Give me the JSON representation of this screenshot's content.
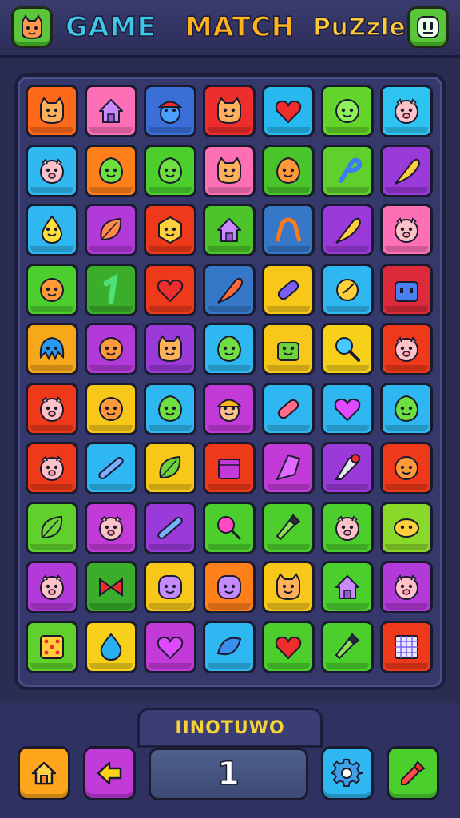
{
  "header": {
    "title_word_1": "GAME",
    "title_word_2": "MATCH",
    "title_word_3": "PuZzle",
    "left_icon": "cat-face-icon",
    "right_icon": "monster-face-icon"
  },
  "board": {
    "rows": 10,
    "cols": 7,
    "tiles": [
      [
        {
          "color": "#ff6a1a",
          "icon": "cat"
        },
        {
          "color": "#ff6fb5",
          "icon": "house"
        },
        {
          "color": "#3a6fd8",
          "icon": "cap-face"
        },
        {
          "color": "#ee2d2d",
          "icon": "cat"
        },
        {
          "color": "#28b8f0",
          "icon": "heart"
        },
        {
          "color": "#62d42a",
          "icon": "face"
        },
        {
          "color": "#2ec4f2",
          "icon": "pig"
        }
      ],
      [
        {
          "color": "#30b8f0",
          "icon": "pig"
        },
        {
          "color": "#ff7f1a",
          "icon": "blob"
        },
        {
          "color": "#4ccf2c",
          "icon": "blob"
        },
        {
          "color": "#ff6fb5",
          "icon": "cat"
        },
        {
          "color": "#49c42a",
          "icon": "blob-orange"
        },
        {
          "color": "#5fd02c",
          "icon": "hook"
        },
        {
          "color": "#9a3ad8",
          "icon": "feather"
        }
      ],
      [
        {
          "color": "#2eb7f0",
          "icon": "drop-face"
        },
        {
          "color": "#b23ad8",
          "icon": "leaf"
        },
        {
          "color": "#ee3a1a",
          "icon": "hex-face"
        },
        {
          "color": "#4cc42a",
          "icon": "house"
        },
        {
          "color": "#3677c8",
          "icon": "arch"
        },
        {
          "color": "#9a3ad8",
          "icon": "feather"
        },
        {
          "color": "#ff6fb5",
          "icon": "pig"
        }
      ],
      [
        {
          "color": "#4ccf2c",
          "icon": "face-orange"
        },
        {
          "color": "#3aae2a",
          "icon": "number-one"
        },
        {
          "color": "#ee3a1a",
          "icon": "heart"
        },
        {
          "color": "#3677c8",
          "icon": "feather-red"
        },
        {
          "color": "#f7c81a",
          "icon": "pill"
        },
        {
          "color": "#2eb7f0",
          "icon": "clock"
        },
        {
          "color": "#dd2a3a",
          "icon": "robot"
        }
      ],
      [
        {
          "color": "#f7a81a",
          "icon": "octopus"
        },
        {
          "color": "#b23ad8",
          "icon": "face-orange"
        },
        {
          "color": "#9a3ad8",
          "icon": "cat"
        },
        {
          "color": "#2eb7f0",
          "icon": "blob"
        },
        {
          "color": "#f7c81a",
          "icon": "tank"
        },
        {
          "color": "#f7d01a",
          "icon": "magnifier"
        },
        {
          "color": "#ee3a1a",
          "icon": "pig"
        }
      ],
      [
        {
          "color": "#ee3a1a",
          "icon": "pig"
        },
        {
          "color": "#f7c81a",
          "icon": "face-orange"
        },
        {
          "color": "#2eb7f0",
          "icon": "blob"
        },
        {
          "color": "#c23ad8",
          "icon": "hat-face"
        },
        {
          "color": "#2eb7f0",
          "icon": "capsule"
        },
        {
          "color": "#2eb7f0",
          "icon": "heart-purple"
        },
        {
          "color": "#2eb7f0",
          "icon": "blob"
        }
      ],
      [
        {
          "color": "#ee3a1a",
          "icon": "pig"
        },
        {
          "color": "#2eb7f0",
          "icon": "pen"
        },
        {
          "color": "#f7c81a",
          "icon": "leaf-green"
        },
        {
          "color": "#ee3a1a",
          "icon": "box"
        },
        {
          "color": "#c23ad8",
          "icon": "kite"
        },
        {
          "color": "#9a3ad8",
          "icon": "cone"
        },
        {
          "color": "#ee3a1a",
          "icon": "face-orange"
        }
      ],
      [
        {
          "color": "#5fd02c",
          "icon": "leaf-green"
        },
        {
          "color": "#c23ad8",
          "icon": "pig"
        },
        {
          "color": "#9a3ad8",
          "icon": "pen"
        },
        {
          "color": "#4ccf2c",
          "icon": "lollipop"
        },
        {
          "color": "#4ccf2c",
          "icon": "dropper"
        },
        {
          "color": "#4ccf2c",
          "icon": "pig"
        },
        {
          "color": "#8ad82a",
          "icon": "lemon"
        }
      ],
      [
        {
          "color": "#b23ad8",
          "icon": "pig"
        },
        {
          "color": "#3aae2a",
          "icon": "bow"
        },
        {
          "color": "#f7c81a",
          "icon": "face-purple"
        },
        {
          "color": "#ff7f1a",
          "icon": "face-purple"
        },
        {
          "color": "#f7c81a",
          "icon": "cat"
        },
        {
          "color": "#4ccf2c",
          "icon": "house"
        },
        {
          "color": "#b23ad8",
          "icon": "pig"
        }
      ],
      [
        {
          "color": "#5fd02c",
          "icon": "dice"
        },
        {
          "color": "#f7d01a",
          "icon": "drop"
        },
        {
          "color": "#c23ad8",
          "icon": "heart-purple"
        },
        {
          "color": "#2eb7f0",
          "icon": "leaf-blue"
        },
        {
          "color": "#4ccf2c",
          "icon": "heart"
        },
        {
          "color": "#4ccf2c",
          "icon": "dropper"
        },
        {
          "color": "#ee3a1a",
          "icon": "grid"
        }
      ]
    ]
  },
  "footer": {
    "label": "IINOTUWO",
    "score": "1",
    "buttons": [
      {
        "name": "home-button",
        "icon": "home-icon",
        "color": "#ffa51c"
      },
      {
        "name": "back-button",
        "icon": "arrow-left-icon",
        "color": "#c23ad8"
      },
      {
        "name": "settings-button",
        "icon": "gear-icon",
        "color": "#2eb7f0"
      },
      {
        "name": "tool-button",
        "icon": "dropper-icon",
        "color": "#4ccf2c"
      }
    ]
  }
}
